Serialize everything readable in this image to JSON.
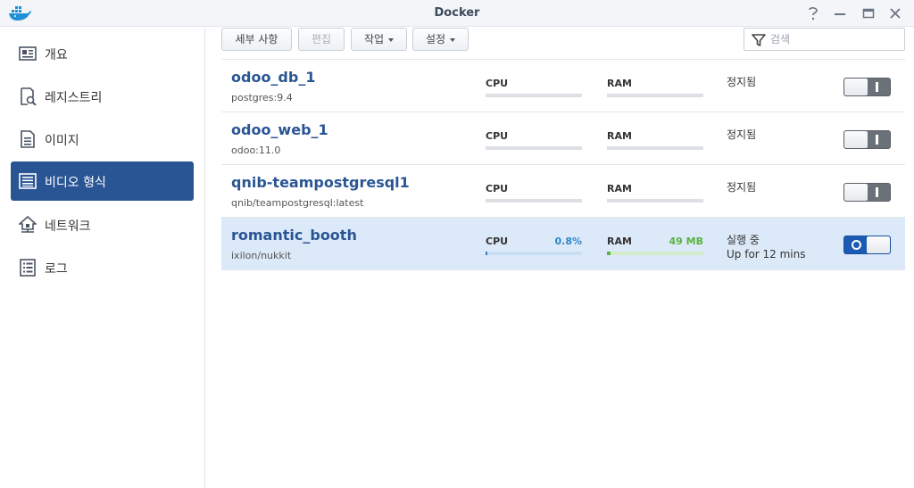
{
  "window": {
    "title": "Docker",
    "app_icon": "docker-whale-icon",
    "controls": [
      "help-icon",
      "minimize-icon",
      "maximize-icon",
      "close-icon"
    ]
  },
  "sidebar": {
    "items": [
      {
        "label": "개요",
        "icon": "overview-icon",
        "active": false
      },
      {
        "label": "레지스트리",
        "icon": "registry-icon",
        "active": false
      },
      {
        "label": "이미지",
        "icon": "image-icon",
        "active": false
      },
      {
        "label": "비디오 형식",
        "icon": "container-icon",
        "active": true
      },
      {
        "label": "네트워크",
        "icon": "network-icon",
        "active": false
      },
      {
        "label": "로그",
        "icon": "log-icon",
        "active": false
      }
    ]
  },
  "toolbar": {
    "details_label": "세부 사항",
    "edit_label": "편집",
    "action_label": "작업",
    "settings_label": "설정",
    "search_placeholder": "검색"
  },
  "containers": [
    {
      "name": "odoo_db_1",
      "image": "postgres:9.4",
      "cpu_label": "CPU",
      "ram_label": "RAM",
      "cpu_value": "",
      "ram_value": "",
      "cpu_percent": 0,
      "ram_fraction": 0,
      "status": "정지됨",
      "uptime": "",
      "running": false
    },
    {
      "name": "odoo_web_1",
      "image": "odoo:11.0",
      "cpu_label": "CPU",
      "ram_label": "RAM",
      "cpu_value": "",
      "ram_value": "",
      "cpu_percent": 0,
      "ram_fraction": 0,
      "status": "정지됨",
      "uptime": "",
      "running": false
    },
    {
      "name": "qnib-teampostgresql1",
      "image": "qnib/teampostgresql:latest",
      "cpu_label": "CPU",
      "ram_label": "RAM",
      "cpu_value": "",
      "ram_value": "",
      "cpu_percent": 0,
      "ram_fraction": 0,
      "status": "정지됨",
      "uptime": "",
      "running": false
    },
    {
      "name": "romantic_booth",
      "image": "ixilon/nukkit",
      "cpu_label": "CPU",
      "ram_label": "RAM",
      "cpu_value": "0.8%",
      "ram_value": "49 MB",
      "cpu_percent": 0.8,
      "ram_fraction": 0.04,
      "status": "실행 중",
      "uptime": "Up for 12 mins",
      "running": true
    }
  ],
  "colors": {
    "accent": "#2a5594",
    "selected_row": "#dce9f8",
    "cpu": "#2f86c8",
    "ram": "#58b340",
    "toggle_on": "#1b5bb4",
    "toggle_off": "#6b7178"
  }
}
